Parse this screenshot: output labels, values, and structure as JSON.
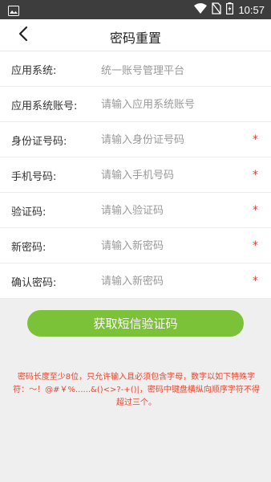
{
  "status_bar": {
    "time": "10:57",
    "icons": [
      "image-icon",
      "wifi-icon",
      "no-sim-icon",
      "battery-icon"
    ]
  },
  "header": {
    "title": "密码重置",
    "back_icon": "chevron-left-icon"
  },
  "form": {
    "rows": [
      {
        "label": "应用系统:",
        "value": "统一账号管理平台",
        "required": false
      },
      {
        "label": "应用系统账号:",
        "placeholder": "请输入应用系统账号",
        "required": false
      },
      {
        "label": "身份证号码:",
        "placeholder": "请输入身份证号码",
        "required": true
      },
      {
        "label": "手机号码:",
        "placeholder": "请输入手机号码",
        "required": true
      },
      {
        "label": "验证码:",
        "placeholder": "请输入验证码",
        "required": true
      },
      {
        "label": "新密码:",
        "placeholder": "请输入新密码",
        "required": true
      },
      {
        "label": "确认密码:",
        "placeholder": "请输入新密码",
        "required": true
      }
    ],
    "required_mark": "*"
  },
  "button": {
    "label": "获取短信验证码"
  },
  "note": "密码长度至少8位，只允许输入且必须包含字母，数字以如下特殊字符：～！@#￥%......&()<>?-+()|，密码中键盘横纵向顺序字符不得超过三个。",
  "colors": {
    "accent": "#7cc238",
    "required": "#e03b2f",
    "note": "#e8472f",
    "status_bar": "#3d3d3d"
  }
}
